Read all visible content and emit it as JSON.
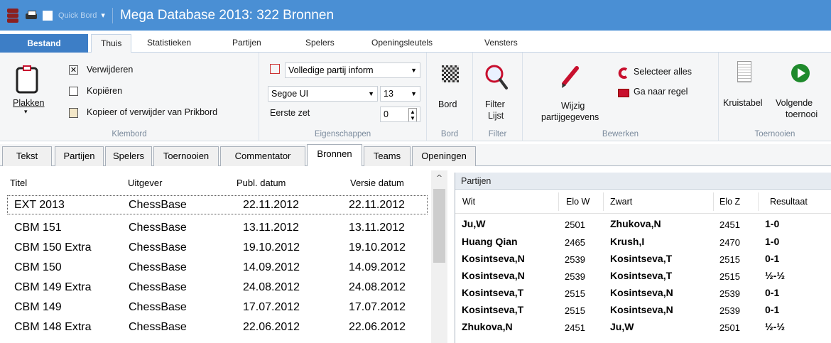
{
  "titlebar": {
    "quick_label": "Quick Bord",
    "title": "Mega Database 2013:  322 Bronnen"
  },
  "ribbon_tabs": {
    "file": "Bestand",
    "home": "Thuis",
    "stats": "Statistieken",
    "games": "Partijen",
    "players": "Spelers",
    "keys": "Openingsleutels",
    "windows": "Vensters"
  },
  "clipboard": {
    "paste": "Plakken",
    "delete": "Verwijderen",
    "copy": "Kopiëren",
    "copy_or_delete": "Kopieer of verwijder van Prikbord",
    "label": "Klembord"
  },
  "properties": {
    "info_combo": "Volledige partij inform",
    "font_combo": "Segoe UI",
    "size_combo": "13",
    "first_move_label": "Eerste zet",
    "first_move_value": "0",
    "label": "Eigenschappen"
  },
  "board_group": {
    "board": "Bord",
    "label": "Bord"
  },
  "filter_group": {
    "filter_list_1": "Filter",
    "filter_list_2": "Lijst",
    "label": "Filter"
  },
  "edit_group": {
    "edit_data_1": "Wijzig",
    "edit_data_2": "partijgegevens",
    "select_all": "Selecteer alles",
    "goto_line": "Ga naar regel",
    "label": "Bewerken"
  },
  "tournament_group": {
    "crosstable": "Kruistabel",
    "next_1": "Volgende",
    "next_2": "toernooi",
    "label": "Toernooien"
  },
  "doc_tabs": [
    "Tekst",
    "Partijen",
    "Spelers",
    "Toernooien",
    "Commentator",
    "Bronnen",
    "Teams",
    "Openingen"
  ],
  "sources": {
    "headers": {
      "title": "Titel",
      "publisher": "Uitgever",
      "pub_date": "Publ. datum",
      "version_date": "Versie datum"
    },
    "rows": [
      {
        "title": "EXT 2013",
        "publisher": "ChessBase",
        "pub": "22.11.2012",
        "ver": "22.11.2012"
      },
      {
        "title": "CBM 151",
        "publisher": "ChessBase",
        "pub": "13.11.2012",
        "ver": "13.11.2012"
      },
      {
        "title": "CBM 150 Extra",
        "publisher": "ChessBase",
        "pub": "19.10.2012",
        "ver": "19.10.2012"
      },
      {
        "title": "CBM 150",
        "publisher": "ChessBase",
        "pub": "14.09.2012",
        "ver": "14.09.2012"
      },
      {
        "title": "CBM 149 Extra",
        "publisher": "ChessBase",
        "pub": "24.08.2012",
        "ver": "24.08.2012"
      },
      {
        "title": "CBM 149",
        "publisher": "ChessBase",
        "pub": "17.07.2012",
        "ver": "17.07.2012"
      },
      {
        "title": "CBM 148 Extra",
        "publisher": "ChessBase",
        "pub": "22.06.2012",
        "ver": "22.06.2012"
      }
    ]
  },
  "games": {
    "panel_title": "Partijen",
    "headers": {
      "white": "Wit",
      "elo_w": "Elo W",
      "black": "Zwart",
      "elo_b": "Elo Z",
      "result": "Resultaat"
    },
    "rows": [
      {
        "white": "Ju,W",
        "elo_w": "2501",
        "black": "Zhukova,N",
        "elo_b": "2451",
        "result": "1-0"
      },
      {
        "white": "Huang Qian",
        "elo_w": "2465",
        "black": "Krush,I",
        "elo_b": "2470",
        "result": "1-0"
      },
      {
        "white": "Kosintseva,N",
        "elo_w": "2539",
        "black": "Kosintseva,T",
        "elo_b": "2515",
        "result": "0-1"
      },
      {
        "white": "Kosintseva,N",
        "elo_w": "2539",
        "black": "Kosintseva,T",
        "elo_b": "2515",
        "result": "½-½"
      },
      {
        "white": "Kosintseva,T",
        "elo_w": "2515",
        "black": "Kosintseva,N",
        "elo_b": "2539",
        "result": "0-1"
      },
      {
        "white": "Kosintseva,T",
        "elo_w": "2515",
        "black": "Kosintseva,N",
        "elo_b": "2539",
        "result": "0-1"
      },
      {
        "white": "Zhukova,N",
        "elo_w": "2451",
        "black": "Ju,W",
        "elo_b": "2501",
        "result": "½-½"
      }
    ]
  }
}
